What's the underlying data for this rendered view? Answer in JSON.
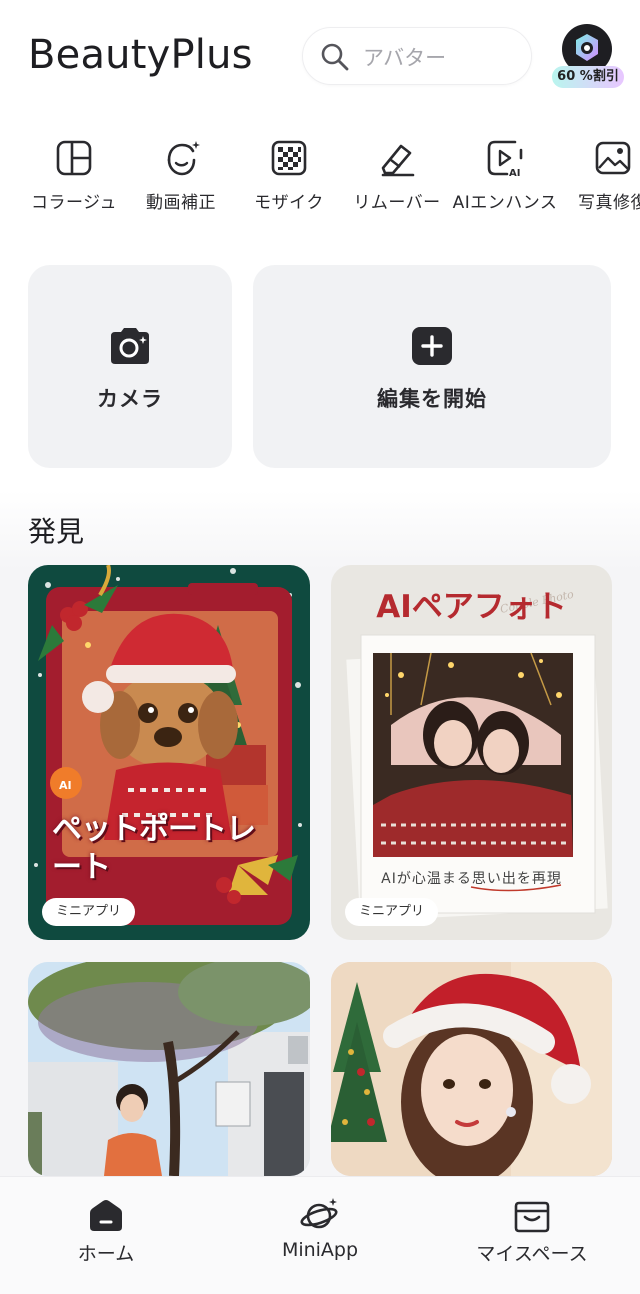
{
  "header": {
    "app_title": "BeautyPlus",
    "search_placeholder": "アバター",
    "promo_badge": "60 %割引"
  },
  "tools": [
    {
      "label": "コラージュ",
      "icon": "collage-icon"
    },
    {
      "label": "動画補正",
      "icon": "face-retouch-icon"
    },
    {
      "label": "モザイク",
      "icon": "mosaic-icon"
    },
    {
      "label": "リムーバー",
      "icon": "eraser-icon"
    },
    {
      "label": "AIエンハンス",
      "icon": "ai-enhance-icon"
    },
    {
      "label": "写真修復",
      "icon": "photo-repair-icon"
    }
  ],
  "actions": {
    "camera_label": "カメラ",
    "edit_label": "編集を開始"
  },
  "discover": {
    "title": "発見",
    "cards": [
      {
        "title": "ペットポートレート",
        "tag": "ミニアプリ",
        "colors": {
          "bg": "#0f4a3f",
          "frame": "#a31d2e"
        }
      },
      {
        "title": "AIペアフォト",
        "subtitle": "AIが心温まる思い出を再現",
        "tag": "ミニアプリ",
        "colors": {
          "bg": "#e9e7e2",
          "accent": "#b52a2f"
        }
      },
      {
        "colors": {
          "sky": "#cfe3f3",
          "wall": "#e7e8ea"
        }
      },
      {
        "colors": {
          "bg": "#e6cdb3",
          "hat": "#c21f2a"
        }
      }
    ]
  },
  "bottom_nav": {
    "home": "ホーム",
    "miniapp": "MiniApp",
    "myspace": "マイスペース"
  }
}
